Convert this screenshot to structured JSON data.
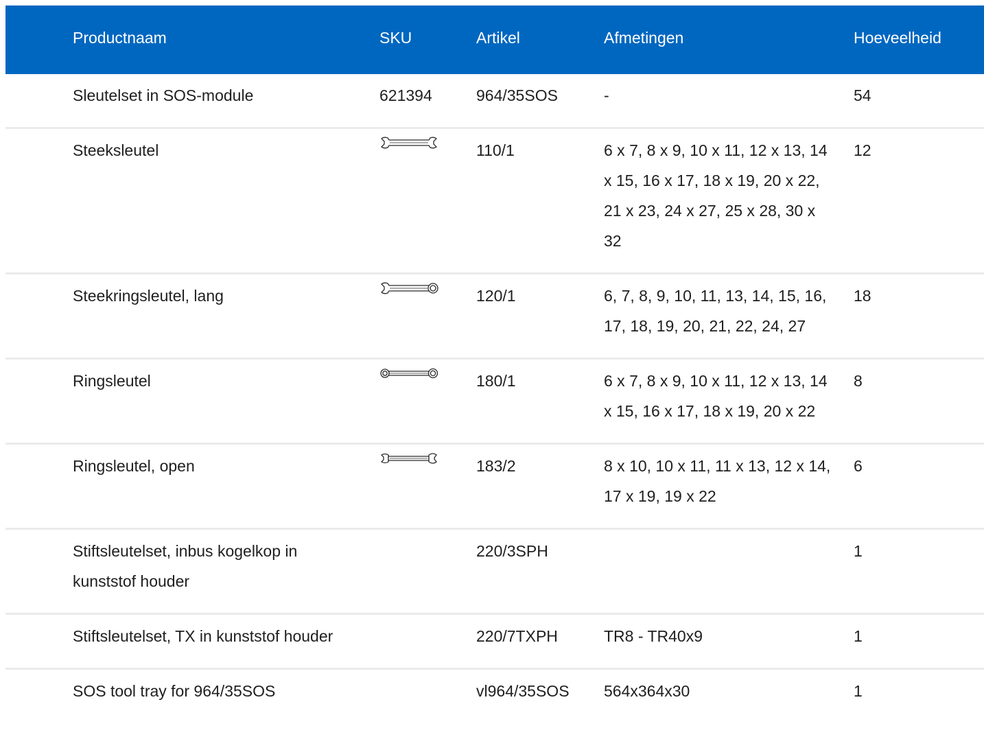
{
  "table": {
    "headers": {
      "name": "Productnaam",
      "sku": "SKU",
      "article": "Artikel",
      "dimensions": "Afmetingen",
      "quantity": "Hoeveelheid"
    },
    "rows": [
      {
        "name": "Sleutelset in SOS-module",
        "sku": "621394",
        "icon": "",
        "article": "964/35SOS",
        "dimensions": "-",
        "quantity": "54"
      },
      {
        "name": "Steeksleutel",
        "sku": "",
        "icon": "open-end-wrench-icon",
        "article": "110/1",
        "dimensions": "6 x 7, 8 x 9, 10 x 11, 12 x 13, 14 x 15, 16 x 17, 18 x 19, 20 x 22, 21 x 23, 24 x 27, 25 x 28, 30 x 32",
        "quantity": "12"
      },
      {
        "name": "Steekringsleutel, lang",
        "sku": "",
        "icon": "combination-wrench-icon",
        "article": "120/1",
        "dimensions": "6, 7, 8, 9, 10, 11, 13, 14, 15, 16, 17, 18, 19, 20, 21, 22, 24, 27",
        "quantity": "18"
      },
      {
        "name": "Ringsleutel",
        "sku": "",
        "icon": "ring-wrench-icon",
        "article": "180/1",
        "dimensions": "6 x 7, 8 x 9, 10 x 11, 12 x 13, 14 x 15, 16 x 17, 18 x 19, 20 x 22",
        "quantity": "8"
      },
      {
        "name": "Ringsleutel, open",
        "sku": "",
        "icon": "flare-nut-wrench-icon",
        "article": "183/2",
        "dimensions": "8 x 10, 10 x 11, 11 x 13, 12 x 14, 17 x 19, 19 x 22",
        "quantity": "6"
      },
      {
        "name": "Stiftsleutelset, inbus kogelkop in kunststof houder",
        "sku": "",
        "icon": "",
        "article": "220/3SPH",
        "dimensions": "",
        "quantity": "1"
      },
      {
        "name": "Stiftsleutelset, TX in kunststof houder",
        "sku": "",
        "icon": "",
        "article": "220/7TXPH",
        "dimensions": "TR8 - TR40x9",
        "quantity": "1"
      },
      {
        "name": "SOS tool tray for 964/35SOS",
        "sku": "",
        "icon": "",
        "article": "vl964/35SOS",
        "dimensions": "564x364x30",
        "quantity": "1"
      }
    ]
  },
  "colors": {
    "header_bg": "#0067c0",
    "header_text": "#ffffff",
    "row_divider": "#ebebeb"
  }
}
